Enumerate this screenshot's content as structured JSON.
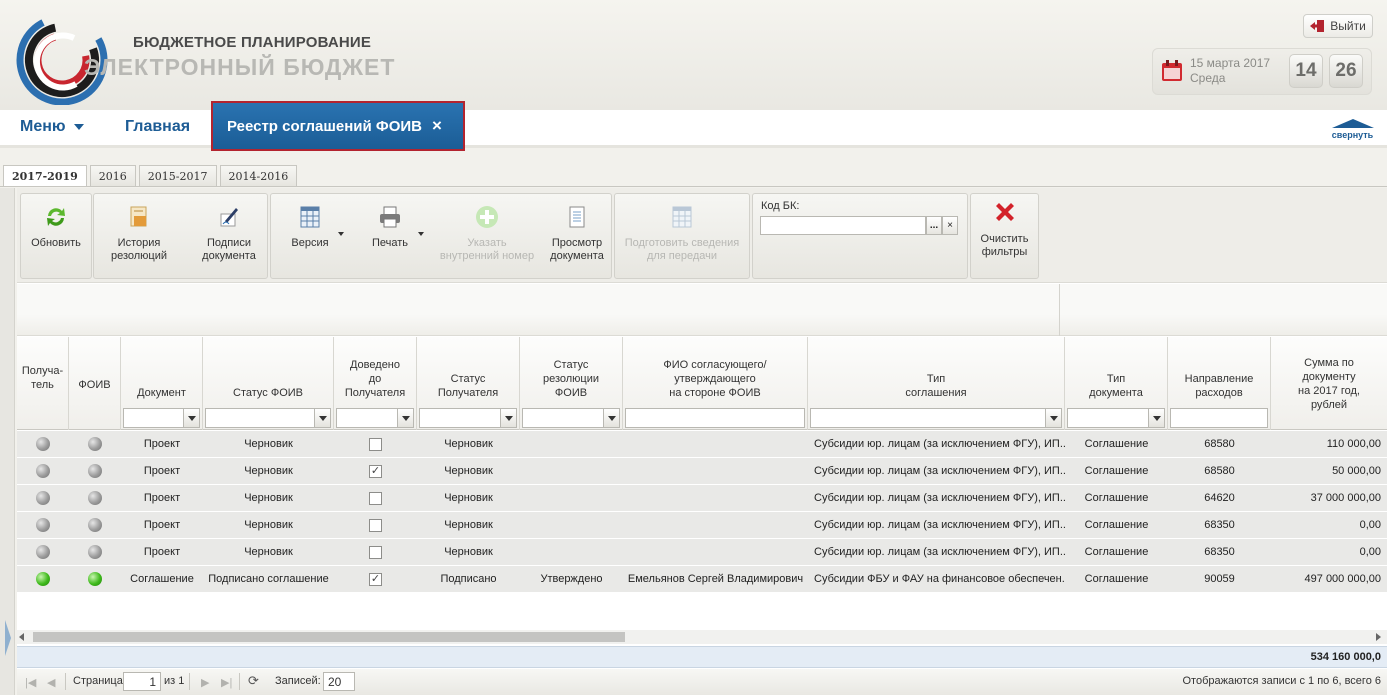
{
  "header": {
    "brand_top": "БЮДЖЕТНОЕ ПЛАНИРОВАНИЕ",
    "brand_main": "ЭЛЕКТРОННЫЙ БЮДЖЕТ",
    "logout_label": "Выйти",
    "date": "15 марта 2017",
    "weekday": "Среда",
    "clock_hours": "14",
    "clock_minutes": "26"
  },
  "nav": {
    "menu_label": "Меню",
    "home_label": "Главная",
    "active_tab_label": "Реестр соглашений ФОИВ",
    "active_tab_close": "×",
    "collapse_label": "свернуть"
  },
  "year_tabs": [
    {
      "label": "2017-2019",
      "active": true
    },
    {
      "label": "2016",
      "active": false
    },
    {
      "label": "2015-2017",
      "active": false
    },
    {
      "label": "2014-2016",
      "active": false
    }
  ],
  "toolbar": {
    "refresh": "Обновить",
    "history_line1": "История",
    "history_line2": "резолюций",
    "signatures_line1": "Подписи",
    "signatures_line2": "документа",
    "version": "Версия",
    "print": "Печать",
    "internal_num_line1": "Указать",
    "internal_num_line2": "внутренний номер",
    "view_doc_line1": "Просмотр",
    "view_doc_line2": "документа",
    "prepare_line1": "Подготовить сведения",
    "prepare_line2": "для передачи",
    "kod_bk_label": "Код БК:",
    "kod_bk_value": "",
    "kod_dots": "...",
    "kod_clear": "×",
    "clear_line1": "Очистить",
    "clear_line2": "фильтры"
  },
  "columns": {
    "recipient": [
      "Получа-",
      "тель"
    ],
    "foiv": [
      "ФОИВ"
    ],
    "document": [
      "Документ"
    ],
    "status_foiv": [
      "Статус ФОИВ"
    ],
    "delivered": [
      "Доведено",
      "до",
      "Получателя"
    ],
    "status_recipient": [
      "Статус",
      "Получателя"
    ],
    "resolution": [
      "Статус",
      "резолюции",
      "ФОИВ"
    ],
    "approver": [
      "ФИО согласующего/",
      "утверждающего",
      "на стороне ФОИВ"
    ],
    "agreement_type": [
      "Тип",
      "соглашения"
    ],
    "doc_type": [
      "Тип",
      "документа"
    ],
    "expense": [
      "Направление",
      "расходов"
    ],
    "amount": [
      "Сумма по",
      "документу",
      "на 2017 год,",
      "рублей"
    ]
  },
  "rows": [
    {
      "recipient_status": "gray",
      "foiv_status": "gray",
      "document": "Проект",
      "status_foiv": "Черновик",
      "delivered": false,
      "status_recipient": "Черновик",
      "resolution": "",
      "approver": "",
      "agreement_type": "Субсидии юр. лицам (за исключением ФГУ), ИП...",
      "doc_type": "Соглашение",
      "expense": "68580",
      "amount": "110 000,00"
    },
    {
      "recipient_status": "gray",
      "foiv_status": "gray",
      "document": "Проект",
      "status_foiv": "Черновик",
      "delivered": true,
      "status_recipient": "Черновик",
      "resolution": "",
      "approver": "",
      "agreement_type": "Субсидии юр. лицам (за исключением ФГУ), ИП...",
      "doc_type": "Соглашение",
      "expense": "68580",
      "amount": "50 000,00"
    },
    {
      "recipient_status": "gray",
      "foiv_status": "gray",
      "document": "Проект",
      "status_foiv": "Черновик",
      "delivered": false,
      "status_recipient": "Черновик",
      "resolution": "",
      "approver": "",
      "agreement_type": "Субсидии юр. лицам (за исключением ФГУ), ИП...",
      "doc_type": "Соглашение",
      "expense": "64620",
      "amount": "37 000 000,00"
    },
    {
      "recipient_status": "gray",
      "foiv_status": "gray",
      "document": "Проект",
      "status_foiv": "Черновик",
      "delivered": false,
      "status_recipient": "Черновик",
      "resolution": "",
      "approver": "",
      "agreement_type": "Субсидии юр. лицам (за исключением ФГУ), ИП...",
      "doc_type": "Соглашение",
      "expense": "68350",
      "amount": "0,00"
    },
    {
      "recipient_status": "gray",
      "foiv_status": "gray",
      "document": "Проект",
      "status_foiv": "Черновик",
      "delivered": false,
      "status_recipient": "Черновик",
      "resolution": "",
      "approver": "",
      "agreement_type": "Субсидии юр. лицам (за исключением ФГУ), ИП...",
      "doc_type": "Соглашение",
      "expense": "68350",
      "amount": "0,00"
    },
    {
      "recipient_status": "green",
      "foiv_status": "green",
      "document": "Соглашение",
      "status_foiv": "Подписано соглашение",
      "delivered": true,
      "status_recipient": "Подписано",
      "resolution": "Утверждено",
      "approver": "Емельянов Сергей Владимирович",
      "agreement_type": "Субсидии ФБУ и ФАУ на финансовое обеспечен...",
      "doc_type": "Соглашение",
      "expense": "90059",
      "amount": "497 000 000,00"
    }
  ],
  "summary": {
    "total": "534 160 000,0"
  },
  "pager": {
    "page_label": "Страница",
    "page_value": "1",
    "of_label": "из 1",
    "records_label": "Записей:",
    "records_value": "20",
    "display_info": "Отображаются записи с 1 по 6, всего 6"
  },
  "colors": {
    "accent": "#1d5c95",
    "active_tab": "#2a73b1",
    "tab_border": "#b3242f",
    "row_bg": "#e9e9e7",
    "status_ok": "#3fba1c"
  }
}
